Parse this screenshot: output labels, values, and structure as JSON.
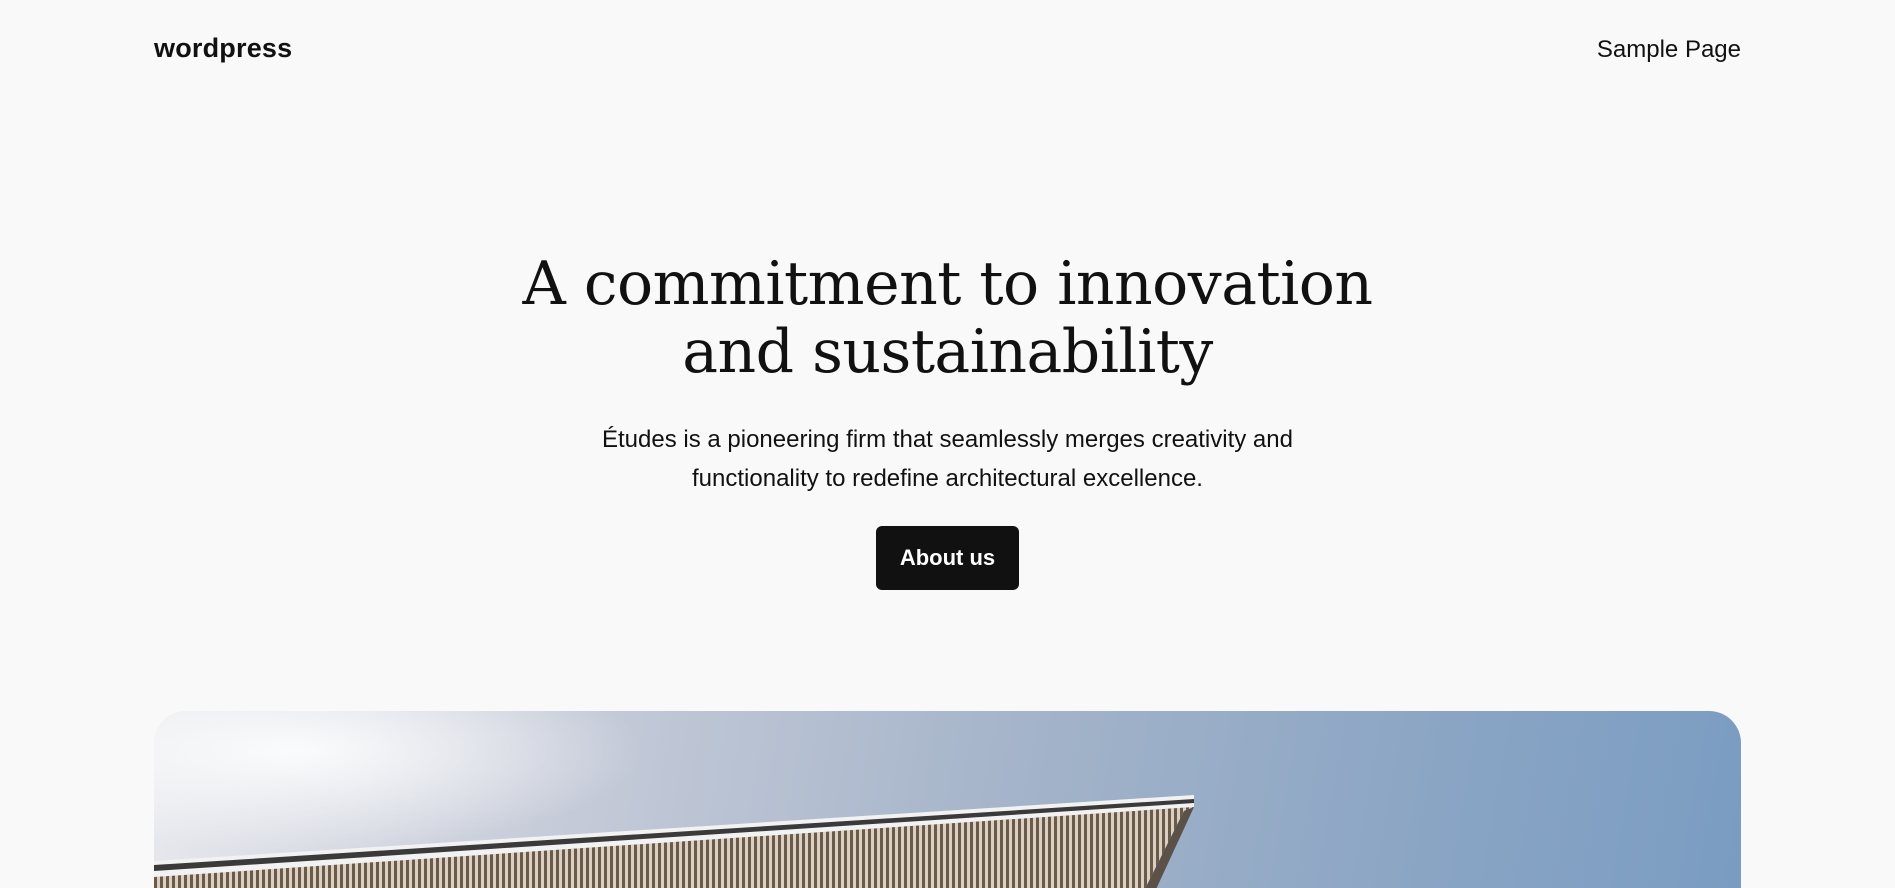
{
  "header": {
    "site_title": "wordpress",
    "nav": [
      {
        "label": "Sample Page"
      }
    ]
  },
  "hero": {
    "title": "A commitment to innovation and sustainability",
    "description": "Études is a pioneering firm that seamlessly merges creativity and functionality to redefine architectural excellence.",
    "button_label": "About us"
  },
  "colors": {
    "background": "#f9f9f9",
    "text": "#111111",
    "button_bg": "#111111",
    "button_text": "#ffffff"
  }
}
